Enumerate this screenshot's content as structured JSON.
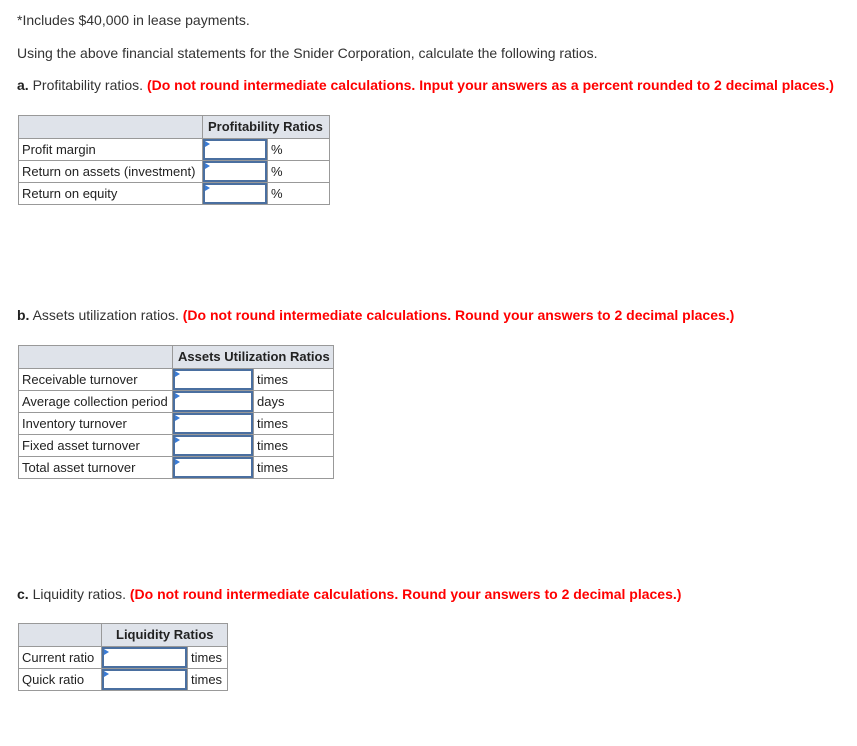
{
  "intro": {
    "footnote": "*Includes $40,000 in lease payments.",
    "prompt": "Using the above financial statements for the Snider Corporation, calculate the following ratios."
  },
  "sections": [
    {
      "letter": "a.",
      "title": "Profitability ratios.",
      "instruction": "(Do not round intermediate calculations. Input your answers as a percent rounded to 2 decimal places.)",
      "table_header": "Profitability Ratios",
      "rows": [
        {
          "label": "Profit margin",
          "value": "",
          "unit": "%"
        },
        {
          "label": "Return on assets (investment)",
          "value": "",
          "unit": "%"
        },
        {
          "label": "Return on equity",
          "value": "",
          "unit": "%"
        }
      ]
    },
    {
      "letter": "b.",
      "title": "Assets utilization ratios.",
      "instruction": "(Do not round intermediate calculations. Round your answers to 2 decimal places.)",
      "table_header": "Assets Utilization Ratios",
      "rows": [
        {
          "label": "Receivable turnover",
          "value": "",
          "unit": "times"
        },
        {
          "label": "Average collection period",
          "value": "",
          "unit": "days"
        },
        {
          "label": "Inventory turnover",
          "value": "",
          "unit": "times"
        },
        {
          "label": "Fixed asset turnover",
          "value": "",
          "unit": "times"
        },
        {
          "label": "Total asset turnover",
          "value": "",
          "unit": "times"
        }
      ]
    },
    {
      "letter": "c.",
      "title": "Liquidity ratios.",
      "instruction": "(Do not round intermediate calculations. Round your answers to 2 decimal places.)",
      "table_header": "Liquidity Ratios",
      "rows": [
        {
          "label": "Current ratio",
          "value": "",
          "unit": "times"
        },
        {
          "label": "Quick ratio",
          "value": "",
          "unit": "times"
        }
      ]
    }
  ],
  "colors": {
    "instruction": "#ff0000",
    "header_bg": "#dfe3ea",
    "input_border": "#4a6fa0",
    "flag": "#3a7bd5",
    "grid": "#999999"
  }
}
